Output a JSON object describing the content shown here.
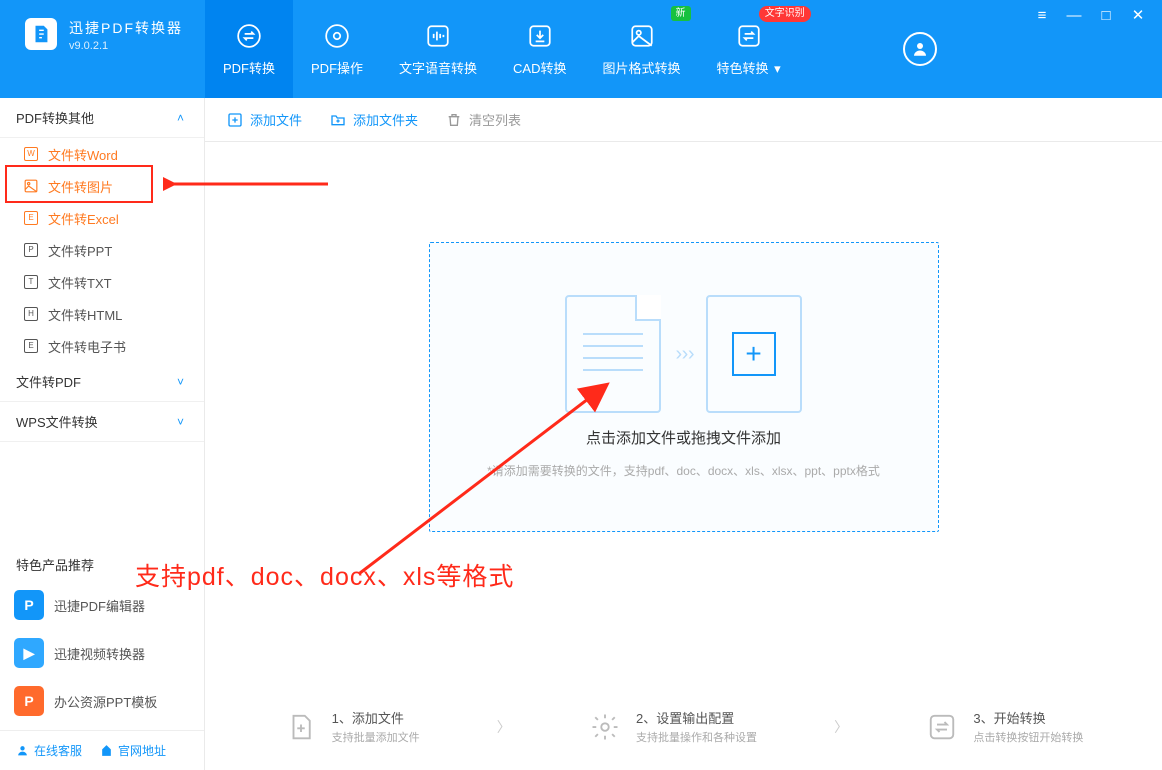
{
  "app": {
    "title": "迅捷PDF转换器",
    "version": "v9.0.2.1"
  },
  "tabs": [
    {
      "label": "PDF转换"
    },
    {
      "label": "PDF操作"
    },
    {
      "label": "文字语音转换"
    },
    {
      "label": "CAD转换"
    },
    {
      "label": "图片格式转换",
      "badge": "新"
    },
    {
      "label": "特色转换",
      "badge": "文字识别",
      "dropdown": true
    }
  ],
  "sidebar": {
    "group1": {
      "title": "PDF转换其他"
    },
    "items": [
      {
        "label": "文件转Word"
      },
      {
        "label": "文件转图片"
      },
      {
        "label": "文件转Excel"
      },
      {
        "label": "文件转PPT"
      },
      {
        "label": "文件转TXT"
      },
      {
        "label": "文件转HTML"
      },
      {
        "label": "文件转电子书"
      }
    ],
    "group2": {
      "title": "文件转PDF"
    },
    "group3": {
      "title": "WPS文件转换"
    }
  },
  "featured": {
    "title": "特色产品推荐",
    "items": [
      {
        "label": "迅捷PDF编辑器",
        "color": "#1296f9",
        "letter": "P"
      },
      {
        "label": "迅捷视频转换器",
        "color": "#2fa8ff",
        "letter": "▶"
      },
      {
        "label": "办公资源PPT模板",
        "color": "#ff6a2c",
        "letter": "P"
      }
    ]
  },
  "footer": {
    "service": "在线客服",
    "site": "官网地址"
  },
  "toolbar": {
    "add_file": "添加文件",
    "add_folder": "添加文件夹",
    "clear": "清空列表"
  },
  "dropzone": {
    "title": "点击添加文件或拖拽文件添加",
    "hint": "*请添加需要转换的文件，支持pdf、doc、docx、xls、xlsx、ppt、pptx格式"
  },
  "steps": [
    {
      "title": "1、添加文件",
      "sub": "支持批量添加文件"
    },
    {
      "title": "2、设置输出配置",
      "sub": "支持批量操作和各种设置"
    },
    {
      "title": "3、开始转换",
      "sub": "点击转换按钮开始转换"
    }
  ],
  "annotation": {
    "text": "支持pdf、doc、docx、xls等格式"
  }
}
